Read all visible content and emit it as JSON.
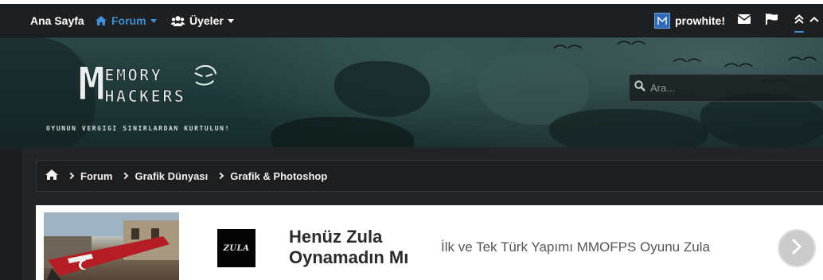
{
  "navbar": {
    "home_label": "Ana Sayfa",
    "forum_label": "Forum",
    "users_label": "Üyeler",
    "username": "prowhite!",
    "accent_color": "#3f8fd2"
  },
  "header": {
    "logo_line1": "EMORY",
    "logo_line2": "HACKERS",
    "logo_initial": "M",
    "tagline": "OYUNUN VERGIGI SINIRLARDAN KURTULUN!",
    "search_placeholder": "Ara..."
  },
  "breadcrumb": {
    "items": [
      "Forum",
      "Grafik Dünyası",
      "Grafik & Photoshop"
    ]
  },
  "ad": {
    "logo_text": "ZULA",
    "title": "Henüz Zula Oynamadın Mı",
    "description": "İlk ve Tek Türk Yapımı MMOFPS Oyunu Zula"
  },
  "icons": [
    "home-icon",
    "users-icon",
    "mail-icon",
    "flag-icon",
    "chevron-up-double-icon",
    "search-icon",
    "chevron-right-icon"
  ]
}
